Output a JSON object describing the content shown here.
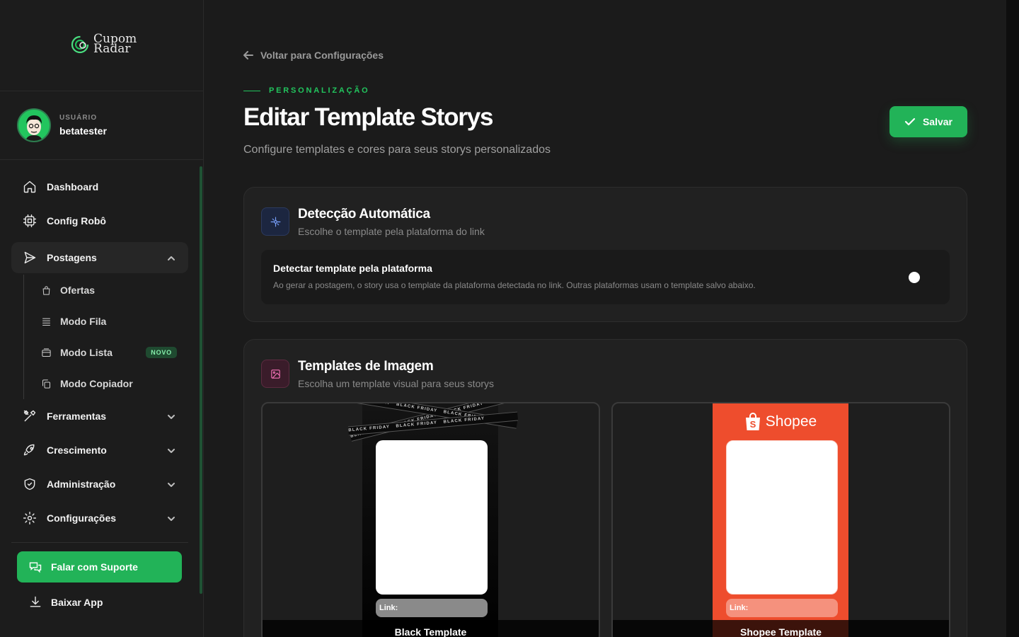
{
  "app": {
    "logo_text_line1": "Cupom",
    "logo_text_line2": "Radar"
  },
  "user": {
    "label": "USUÁRIO",
    "name": "betatester"
  },
  "nav": {
    "dashboard": "Dashboard",
    "config_robo": "Config Robô",
    "postagens": "Postagens",
    "sub": {
      "ofertas": "Ofertas",
      "modo_fila": "Modo Fila",
      "modo_lista": "Modo Lista",
      "modo_lista_badge": "NOVO",
      "modo_copiador": "Modo Copiador"
    },
    "ferramentas": "Ferramentas",
    "crescimento": "Crescimento",
    "administracao": "Administração",
    "configuracoes": "Configurações",
    "support": "Falar com Suporte",
    "download": "Baixar App"
  },
  "header": {
    "back": "Voltar para Configurações",
    "eyebrow": "PERSONALIZAÇÃO",
    "title": "Editar Template Storys",
    "subtitle": "Configure templates e cores para seus storys personalizados",
    "save": "Salvar"
  },
  "auto_detect": {
    "title": "Detecção Automática",
    "subtitle": "Escolhe o template pela plataforma do link",
    "toggle_title": "Detectar template pela plataforma",
    "toggle_desc": "Ao gerar a postagem, o story usa o template da plataforma detectada no link. Outras plataformas usam o template salvo abaixo.",
    "enabled": false
  },
  "templates": {
    "title": "Templates de Imagem",
    "subtitle": "Escolha um template visual para seus storys",
    "items": [
      {
        "name": "Black Template",
        "link_label": "Link:",
        "band_text": "BLACK FRIDAY"
      },
      {
        "name": "Shopee Template",
        "link_label": "Link:",
        "brand": "Shopee"
      }
    ]
  },
  "colors": {
    "accent": "#22c55e",
    "button": "#22b358",
    "shopee": "#ee4d2d"
  }
}
